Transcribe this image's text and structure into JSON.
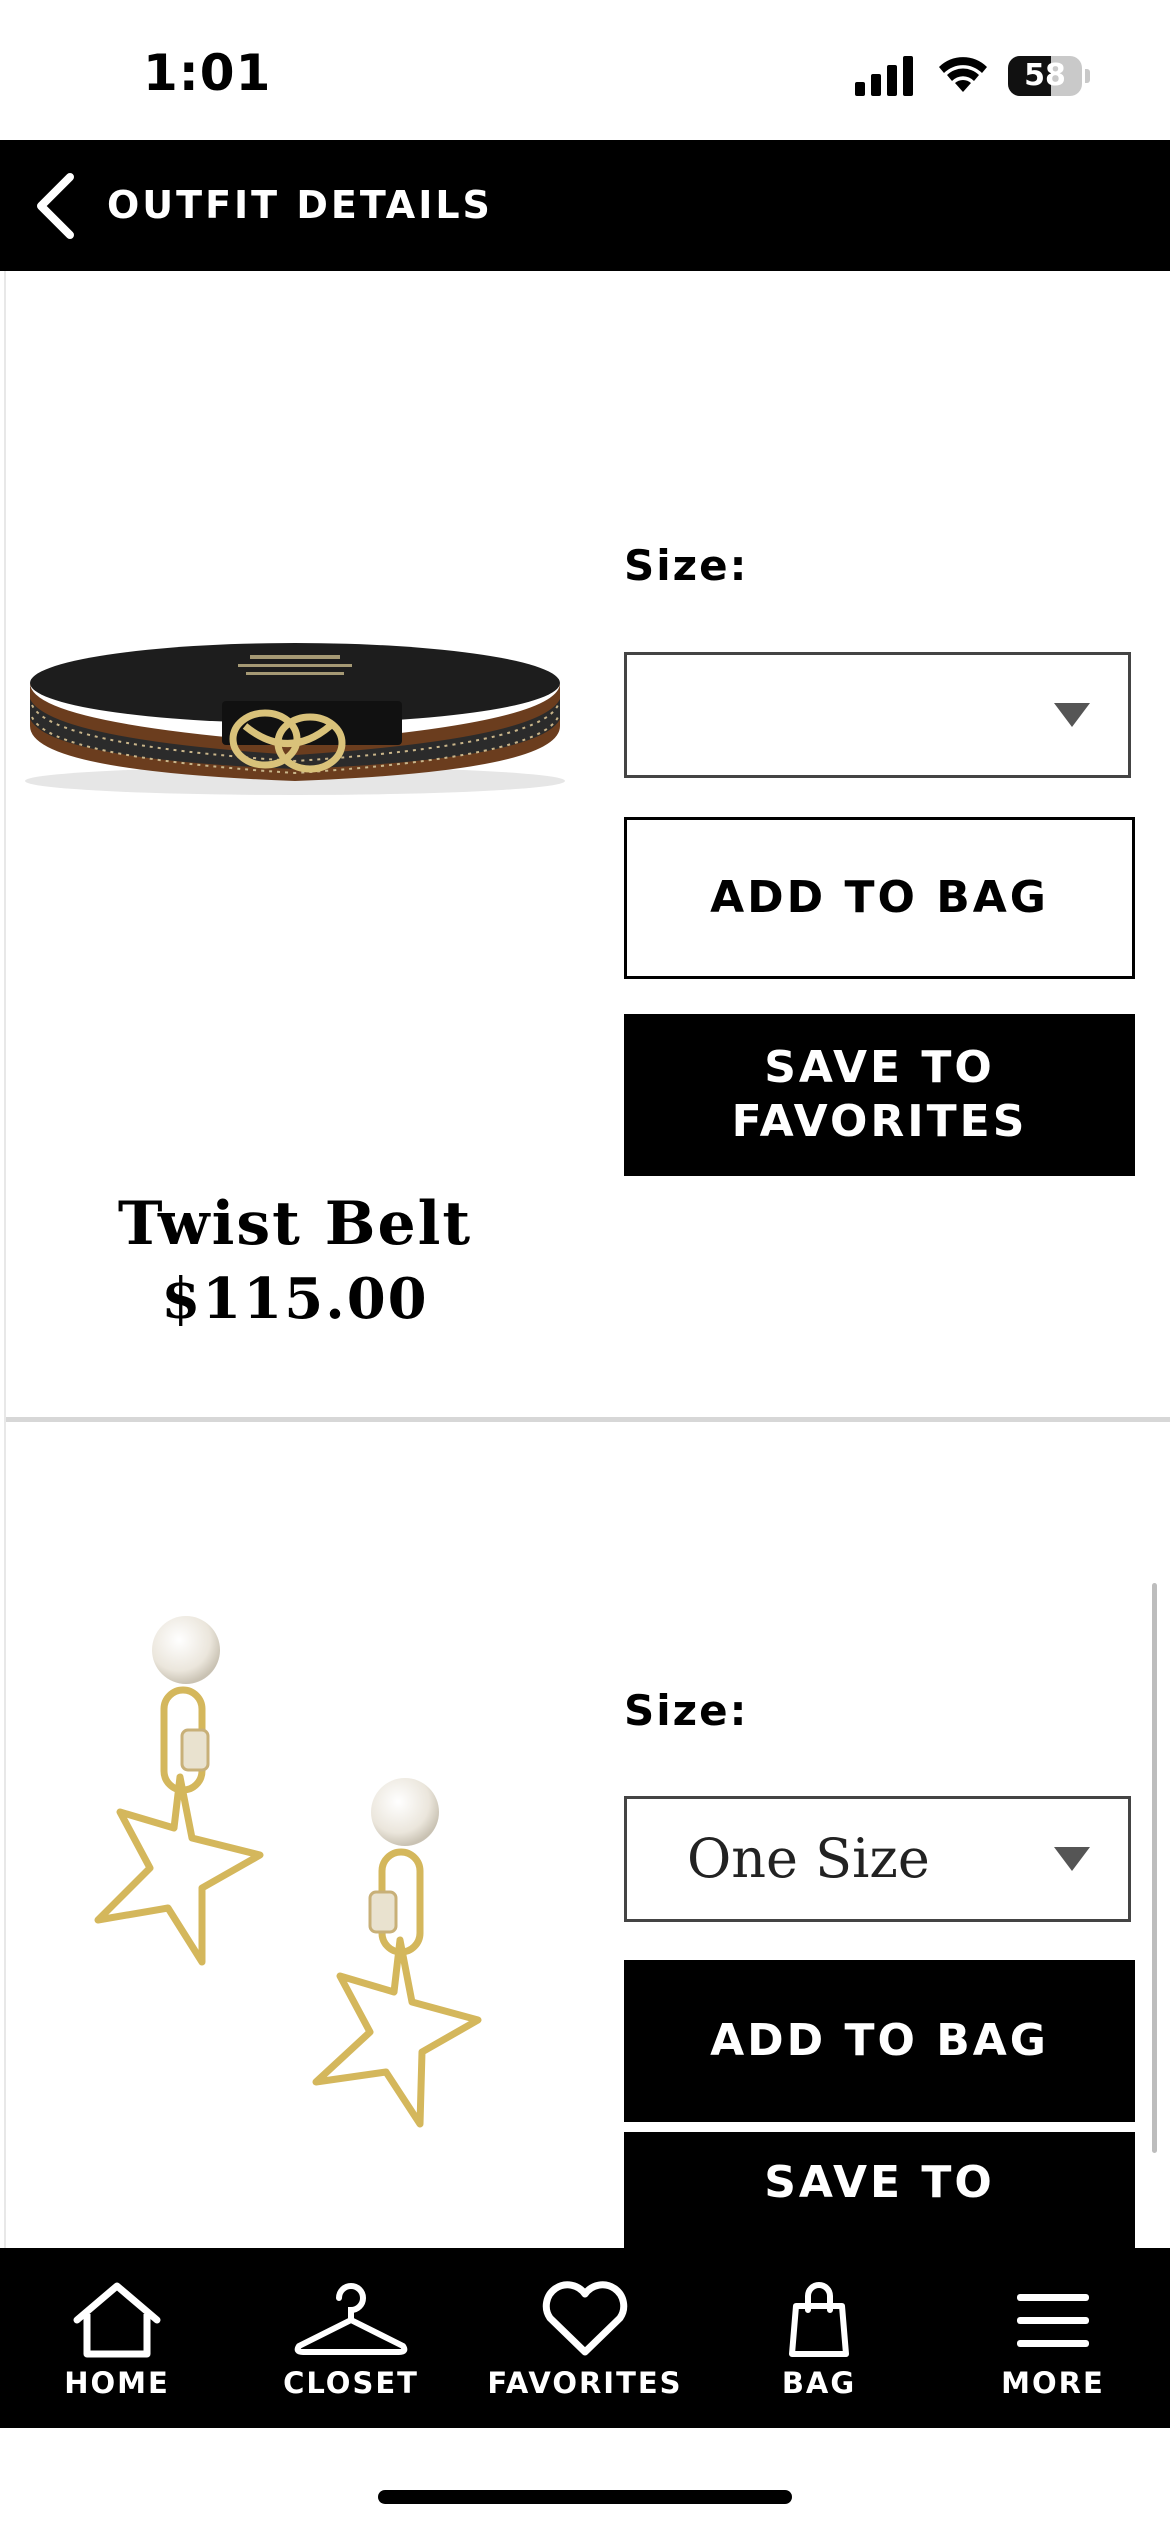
{
  "status_bar": {
    "time": "1:01",
    "battery": "58",
    "battery_level": 0.58
  },
  "header": {
    "title": "OUTFIT DETAILS"
  },
  "products": [
    {
      "name": "Twist Belt",
      "price": "$115.00",
      "size_label": "Size:",
      "size_value": "",
      "add_to_bag": "ADD TO BAG",
      "save_to_favorites": "SAVE TO\nFAVORITES"
    },
    {
      "size_label": "Size:",
      "size_value": "One Size",
      "add_to_bag": "ADD TO BAG",
      "save_to_favorites": "SAVE TO"
    }
  ],
  "tab_bar": {
    "items": [
      {
        "label": "HOME",
        "icon": "home-icon"
      },
      {
        "label": "CLOSET",
        "icon": "hanger-icon"
      },
      {
        "label": "FAVORITES",
        "icon": "heart-icon"
      },
      {
        "label": "BAG",
        "icon": "shopping-bag-icon"
      },
      {
        "label": "MORE",
        "icon": "menu-icon"
      }
    ]
  },
  "colors": {
    "header_bg": "#000000",
    "tab_bar_bg": "#000000",
    "divider": "#d7d7d7"
  }
}
